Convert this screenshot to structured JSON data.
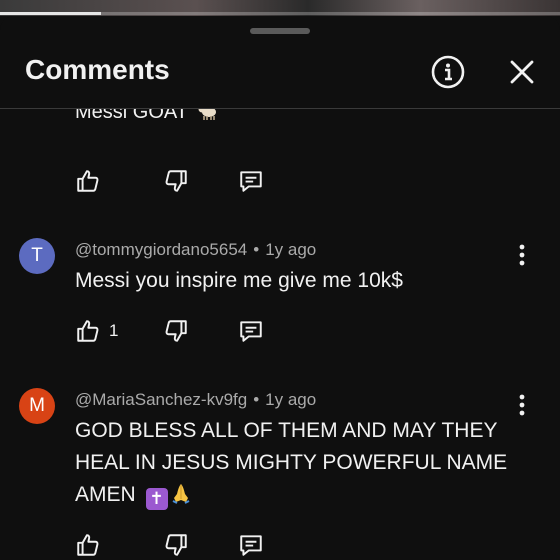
{
  "video": {
    "progress": 0.18
  },
  "header": {
    "title": "Comments",
    "info_icon": "info-icon",
    "close_icon": "close-icon"
  },
  "partial_comment": {
    "text": "Messi GOAT",
    "emoji": "goat"
  },
  "comments": [
    {
      "avatar_letter": "T",
      "avatar_color": "#5c6bc0",
      "author": "@tommygiordano5654",
      "separator": "•",
      "time": "1y ago",
      "text": "Messi you inspire me give me 10k$",
      "likes": "1"
    },
    {
      "avatar_letter": "M",
      "avatar_color": "#d84315",
      "author": "@MariaSanchez-kv9fg",
      "separator": "•",
      "time": "1y ago",
      "text": "GOD BLESS ALL OF THEM AND MAY THEY HEAL IN JESUS MIGHTY POWERFUL NAME AMEN",
      "emoji_cross": "✝",
      "emoji_hands": "🙏",
      "likes": ""
    }
  ]
}
